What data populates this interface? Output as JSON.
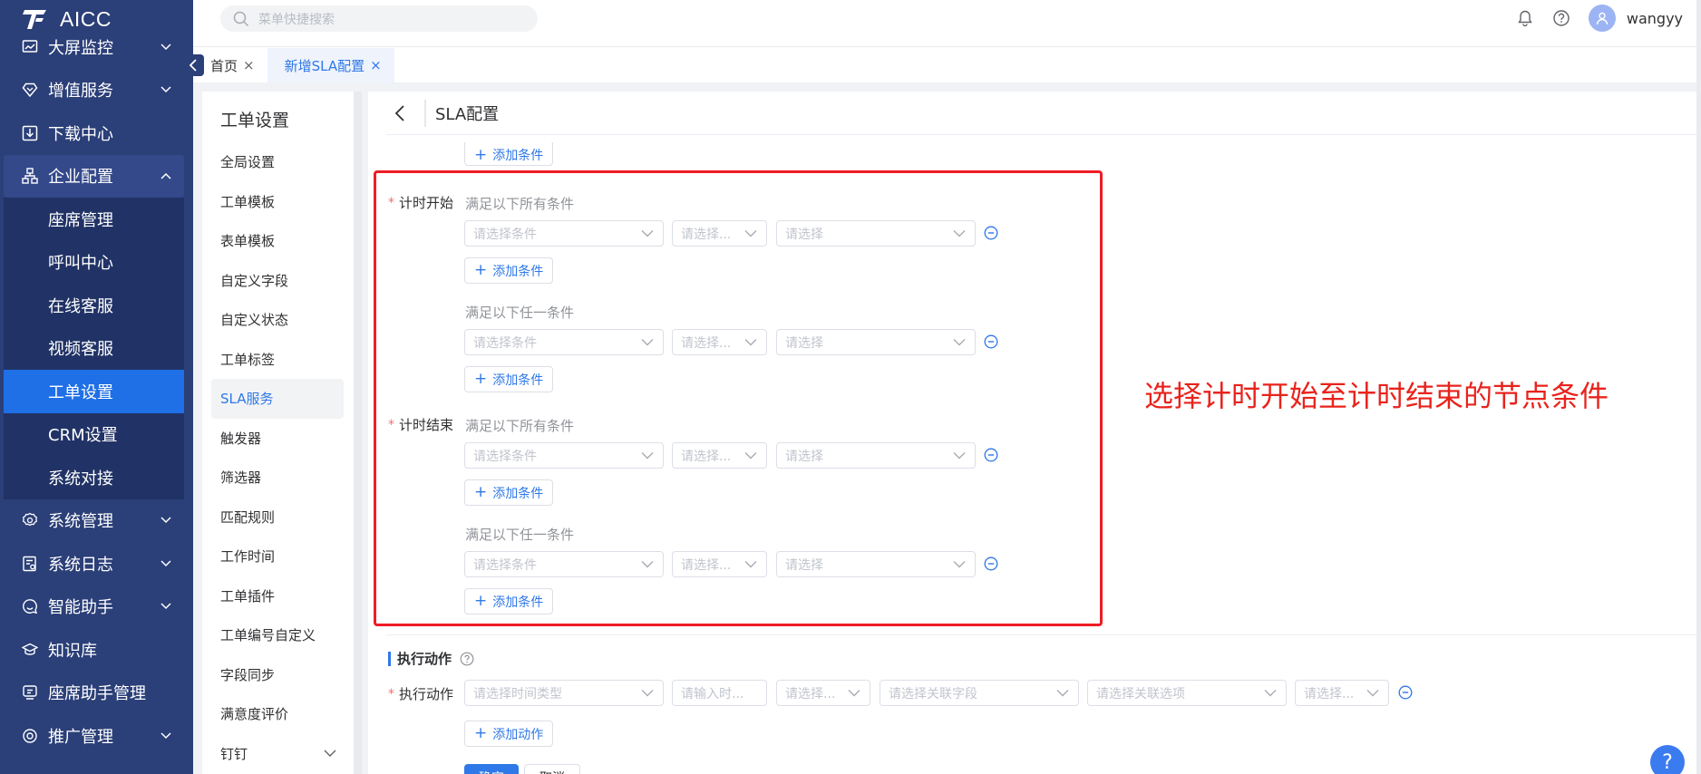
{
  "app": {
    "title": "AICC",
    "user": "wangyy"
  },
  "search": {
    "placeholder": "菜单快捷搜索"
  },
  "sidebar": {
    "items": [
      {
        "label": "大屏监控",
        "icon": "chart-icon"
      },
      {
        "label": "增值服务",
        "icon": "diamond-icon"
      },
      {
        "label": "下载中心",
        "icon": "download-icon"
      },
      {
        "label": "企业配置",
        "icon": "org-icon"
      },
      {
        "label": "系统管理",
        "icon": "gear-icon"
      },
      {
        "label": "系统日志",
        "icon": "log-icon"
      },
      {
        "label": "智能助手",
        "icon": "chat-icon"
      },
      {
        "label": "知识库",
        "icon": "book-icon"
      },
      {
        "label": "座席助手管理",
        "icon": "assistant-icon"
      },
      {
        "label": "推广管理",
        "icon": "promo-icon"
      }
    ],
    "sub": [
      "座席管理",
      "呼叫中心",
      "在线客服",
      "视频客服",
      "工单设置",
      "CRM设置",
      "系统对接"
    ]
  },
  "tabs": [
    {
      "label": "首页"
    },
    {
      "label": "新增SLA配置"
    }
  ],
  "subnav": {
    "title": "工单设置",
    "items": [
      "全局设置",
      "工单模板",
      "表单模板",
      "自定义字段",
      "自定义状态",
      "工单标签",
      "SLA服务",
      "触发器",
      "筛选器",
      "匹配规则",
      "工作时间",
      "工单插件",
      "工单编号自定义",
      "字段同步",
      "满意度评价",
      "钉钉"
    ]
  },
  "page": {
    "title": "SLA配置"
  },
  "form": {
    "add_condition": "添加条件",
    "timer_start": "计时开始",
    "timer_end": "计时结束",
    "match_all": "满足以下所有条件",
    "match_any": "满足以下任一条件",
    "ph_condition": "请选择条件",
    "ph_operator": "请选择...",
    "ph_value": "请选择",
    "annotation": "选择计时开始至计时结束的节点条件"
  },
  "action": {
    "section_title": "执行动作",
    "label": "执行动作",
    "ph_time_type": "请选择时间类型",
    "ph_time_input": "请输入时...",
    "ph_select1": "请选择...",
    "ph_field": "请选择关联字段",
    "ph_option": "请选择关联选项",
    "ph_select2": "请选择...",
    "add_action": "添加动作",
    "confirm": "确定",
    "cancel": "取消"
  },
  "colors": {
    "sidebar": "#2b3f78",
    "accent": "#2f78e8",
    "highlight": "#ee1c25"
  }
}
